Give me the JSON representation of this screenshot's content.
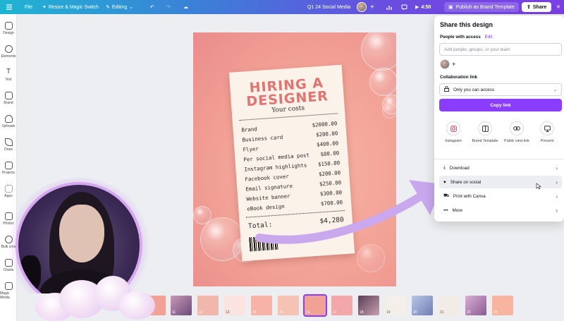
{
  "topbar": {
    "file": "File",
    "resize": "Resize & Magic Switch",
    "editing": "Editing",
    "doc_title": "Q1 24 Social Media",
    "timer": "4:50",
    "publish": "Publish as Brand Template",
    "share": "Share"
  },
  "rail": [
    "Design",
    "Elements",
    "Text",
    "Brand",
    "Uploads",
    "Draw",
    "Projects",
    "Apps",
    "Photos",
    "Bulk crea",
    "Charts",
    "Magic Media"
  ],
  "poster": {
    "title_line1": "HIRING A",
    "title_line2": "DESIGNER",
    "subtitle": "Your costs",
    "items": [
      {
        "name": "Brand",
        "price": "$2000.00"
      },
      {
        "name": "Business card",
        "price": "$200.00"
      },
      {
        "name": "Flyer",
        "price": "$400.00"
      },
      {
        "name": "Per social media post",
        "price": "$80.00"
      },
      {
        "name": "Instagram highlights",
        "price": "$150.00"
      },
      {
        "name": "Facebook cover",
        "price": "$200.00"
      },
      {
        "name": "Email signature",
        "price": "$250.00"
      },
      {
        "name": "Website banner",
        "price": "$300.00"
      },
      {
        "name": "eBook design",
        "price": "$700.00"
      }
    ],
    "total_label": "Total:",
    "total_value": "$4,280"
  },
  "filmstrip": [
    "10",
    "11",
    "12",
    "13",
    "14",
    "15",
    "16",
    "17",
    "18",
    "19",
    "20",
    "21",
    "22",
    "23"
  ],
  "filmstrip_selected": "15",
  "share_panel": {
    "title": "Share this design",
    "people_label": "People with access",
    "edit": "Edit",
    "add_placeholder": "Add people, groups, or your team",
    "collab_label": "Collaboration link",
    "access_value": "Only you can access",
    "copy_link": "Copy link",
    "options": [
      {
        "label": "Instagram",
        "icon": "instagram-icon"
      },
      {
        "label": "Brand Template",
        "icon": "brand-template-icon"
      },
      {
        "label": "Public view link",
        "icon": "link-icon"
      },
      {
        "label": "Present",
        "icon": "present-icon"
      }
    ],
    "rows": [
      {
        "label": "Download",
        "icon": "download-icon"
      },
      {
        "label": "Share on social",
        "icon": "heart-icon"
      },
      {
        "label": "Print with Canva",
        "icon": "truck-icon"
      },
      {
        "label": "More",
        "icon": "more-icon"
      }
    ]
  },
  "colors": {
    "accent": "#8b3dff",
    "poster_title": "#e4736f"
  }
}
